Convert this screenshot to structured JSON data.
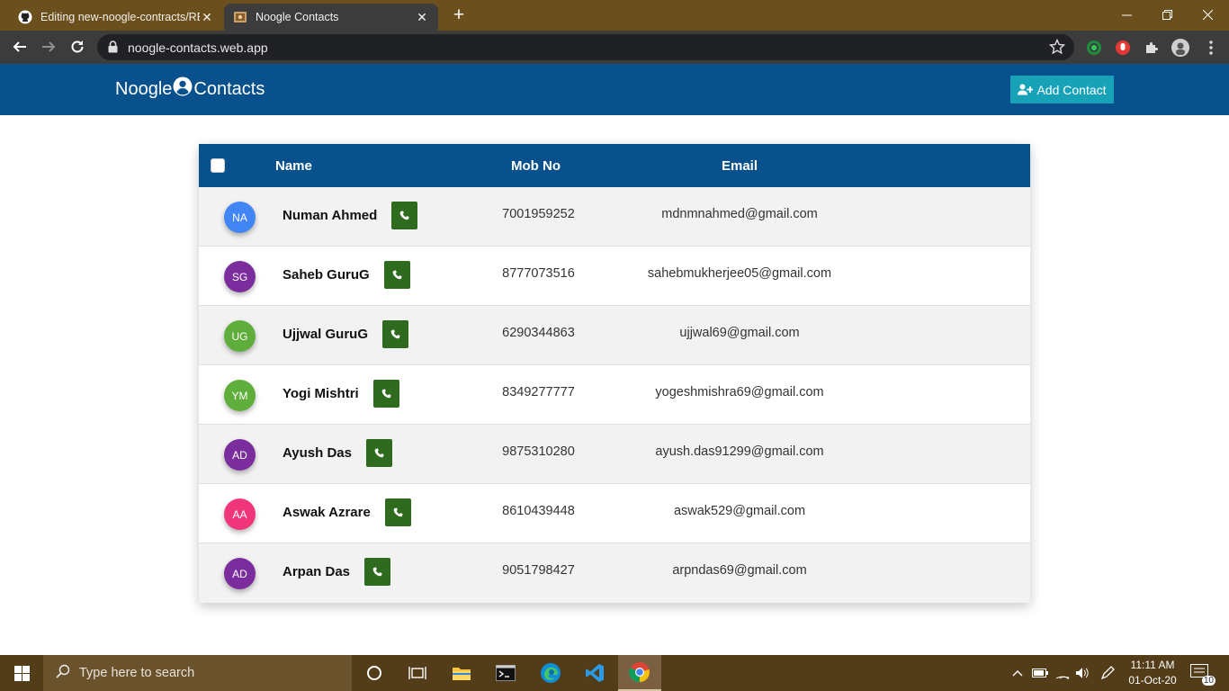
{
  "browser": {
    "tabs": [
      {
        "title": "Editing new-noogle-contracts/RE",
        "icon": "github-icon"
      },
      {
        "title": "Noogle Contacts",
        "icon": "site-favicon"
      }
    ],
    "url": "noogle-contacts.web.app"
  },
  "app": {
    "brand_left": "Noogle",
    "brand_right": "Contacts",
    "add_contact_label": "Add Contact"
  },
  "table": {
    "headers": {
      "name": "Name",
      "mobile": "Mob No",
      "email": "Email"
    },
    "rows": [
      {
        "initials": "NA",
        "name": "Numan Ahmed",
        "mobile": "7001959252",
        "email": "mdnmnahmed@gmail.com",
        "avatar_color": "#4285f4"
      },
      {
        "initials": "SG",
        "name": "Saheb GuruG",
        "mobile": "8777073516",
        "email": "sahebmukherjee05@gmail.com",
        "avatar_color": "#7b2d9e"
      },
      {
        "initials": "UG",
        "name": "Ujjwal GuruG",
        "mobile": "6290344863",
        "email": "ujjwal69@gmail.com",
        "avatar_color": "#5fae3c"
      },
      {
        "initials": "YM",
        "name": "Yogi Mishtri",
        "mobile": "8349277777",
        "email": "yogeshmishra69@gmail.com",
        "avatar_color": "#5fae3c"
      },
      {
        "initials": "AD",
        "name": "Ayush Das",
        "mobile": "9875310280",
        "email": "ayush.das91299@gmail.com",
        "avatar_color": "#7b2d9e"
      },
      {
        "initials": "AA",
        "name": "Aswak Azrare",
        "mobile": "8610439448",
        "email": "aswak529@gmail.com",
        "avatar_color": "#f0357a"
      },
      {
        "initials": "AD",
        "name": "Arpan Das",
        "mobile": "9051798427",
        "email": "arpndas69@gmail.com",
        "avatar_color": "#7b2d9e"
      }
    ]
  },
  "taskbar": {
    "search_placeholder": "Type here to search",
    "time": "11:11 AM",
    "date": "01-Oct-20",
    "notification_count": "10"
  },
  "colors": {
    "header_blue": "#08518c",
    "add_button": "#17a2b8",
    "call_button": "#2e6b1f"
  }
}
